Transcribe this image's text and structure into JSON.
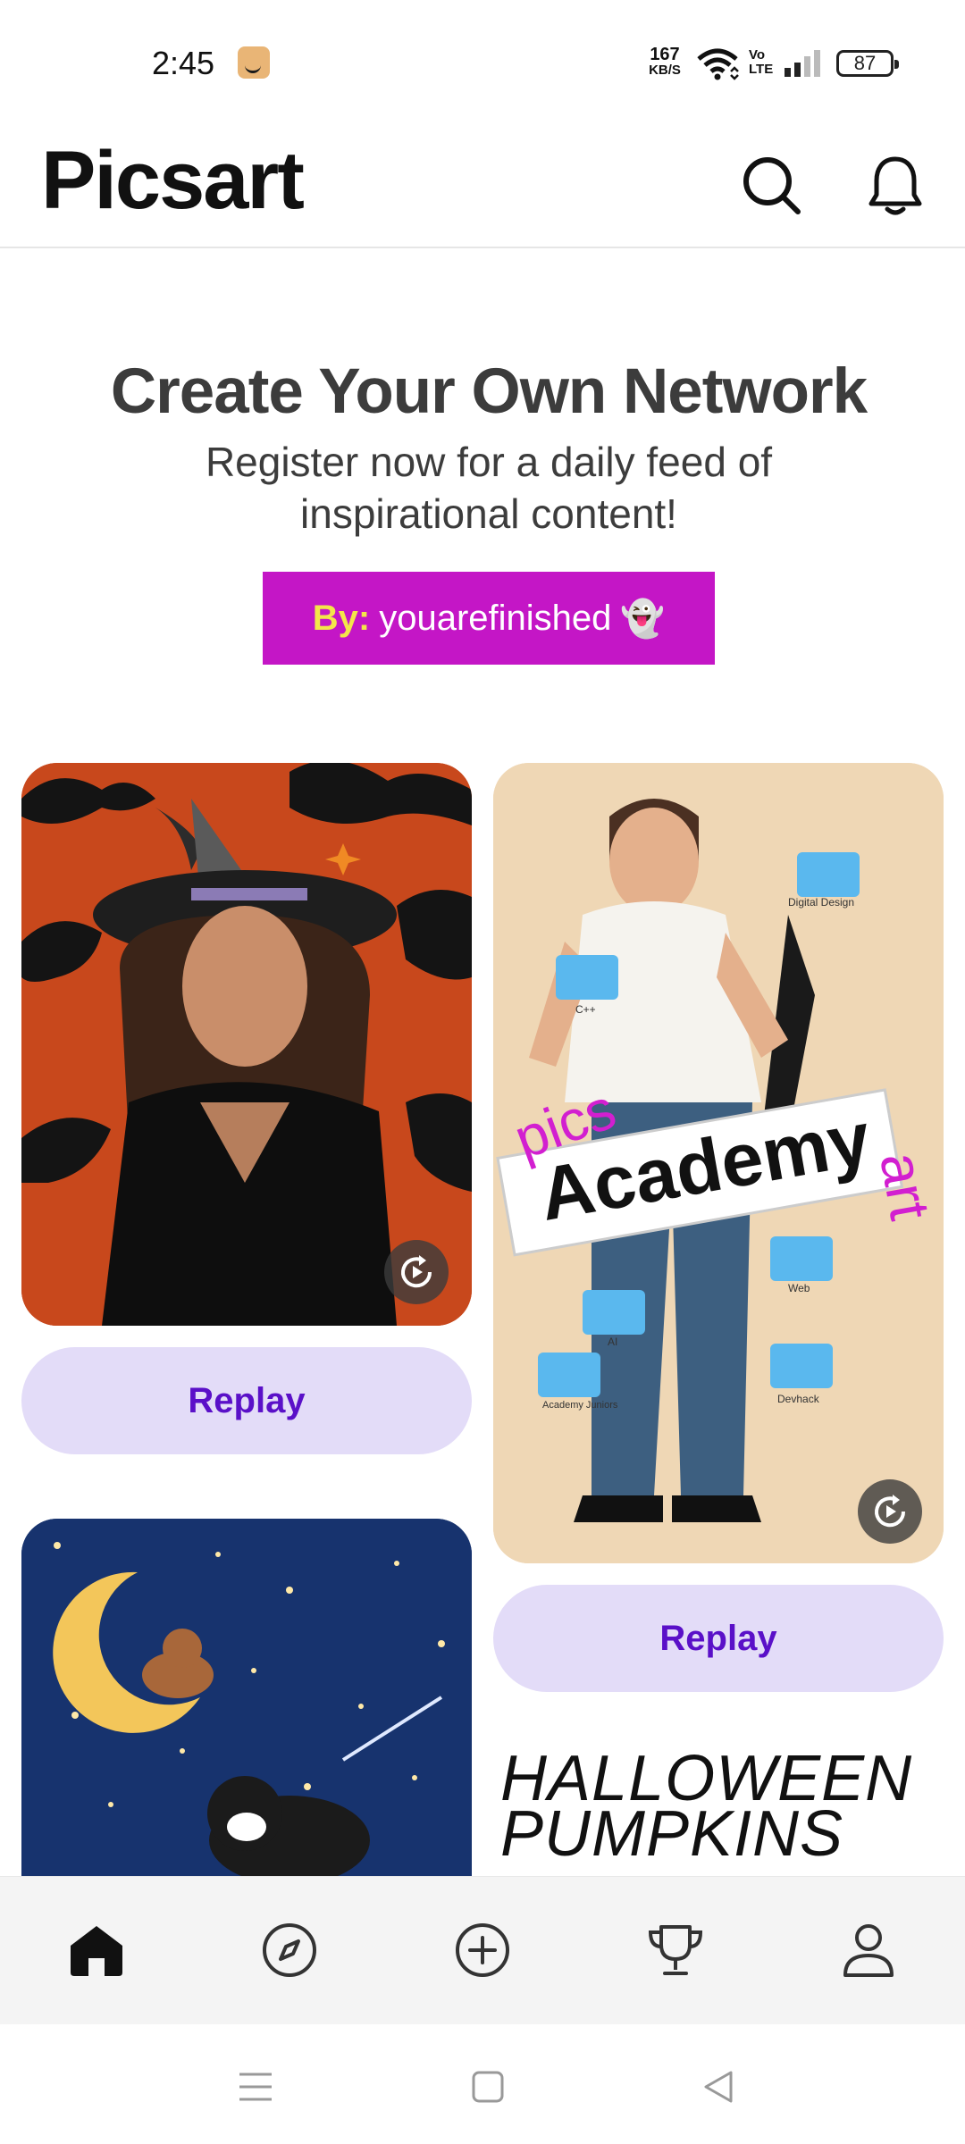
{
  "status_bar": {
    "time": "2:45",
    "net_speed_value": "167",
    "net_speed_unit": "KB/S",
    "volte_line1": "Vo",
    "volte_line2": "LTE",
    "battery": "87"
  },
  "header": {
    "logo": "Picsart"
  },
  "banner": {
    "title": "Create Your Own Network",
    "subtitle": "Register now for a daily feed of inspirational content!",
    "author_prefix": "By:",
    "author_name": "youarefinished",
    "author_emoji": "👻"
  },
  "feed": {
    "card2_labels": {
      "digital_design": "Digital Design",
      "cpp": "C++",
      "academy": "Academy",
      "pics": "pics",
      "art": "art",
      "web": "Web",
      "ai": "AI",
      "academy_juniors": "Academy Juniors",
      "devhack": "Devhack"
    },
    "replay_label_1": "Replay",
    "replay_label_2": "Replay",
    "halloween_text_line1": "HALLOWEEN",
    "halloween_text_line2": "PUMPKINS"
  },
  "colors": {
    "brand_magenta": "#c416c6",
    "prefix_yellow": "#f4e64a",
    "replay_bg": "#e3dcf8",
    "replay_text": "#5a10c8"
  },
  "bottom_nav": {
    "items": [
      "home-icon",
      "discover-icon",
      "create-icon",
      "challenges-icon",
      "profile-icon"
    ],
    "active": "home-icon"
  }
}
